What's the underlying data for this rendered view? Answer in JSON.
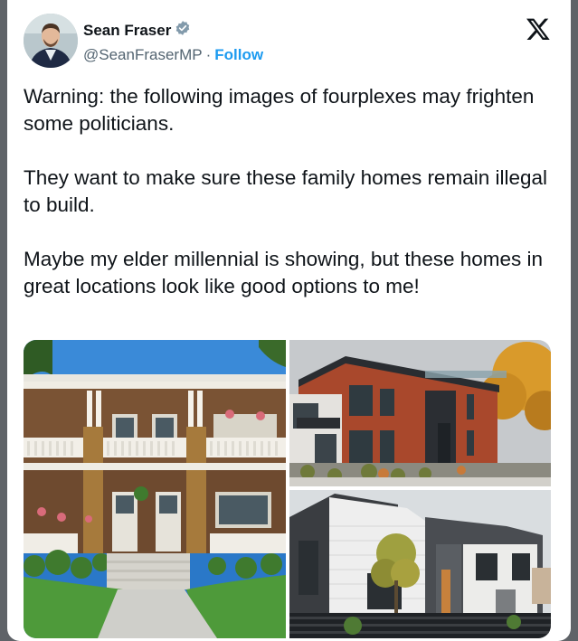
{
  "author": {
    "display_name": "Sean Fraser",
    "handle": "@SeanFraserMP",
    "separator": "·",
    "follow_label": "Follow",
    "verified": true
  },
  "tweet": {
    "paragraphs": [
      "Warning: the following images of fourplexes may frighten some politicians.",
      "They want to make sure these family homes remain illegal to build.",
      "Maybe my elder millennial is showing, but these homes in great locations look like good options to me!"
    ]
  },
  "media": [
    {
      "icon": "photo-brick-fourplex-porches"
    },
    {
      "icon": "photo-modern-red-brick-fourplex"
    },
    {
      "icon": "photo-modern-grey-siding-fourplex"
    }
  ],
  "colors": {
    "accent": "#1d9bf0",
    "text": "#0f1419",
    "secondary_text": "#536471",
    "background": "#5f6368"
  }
}
